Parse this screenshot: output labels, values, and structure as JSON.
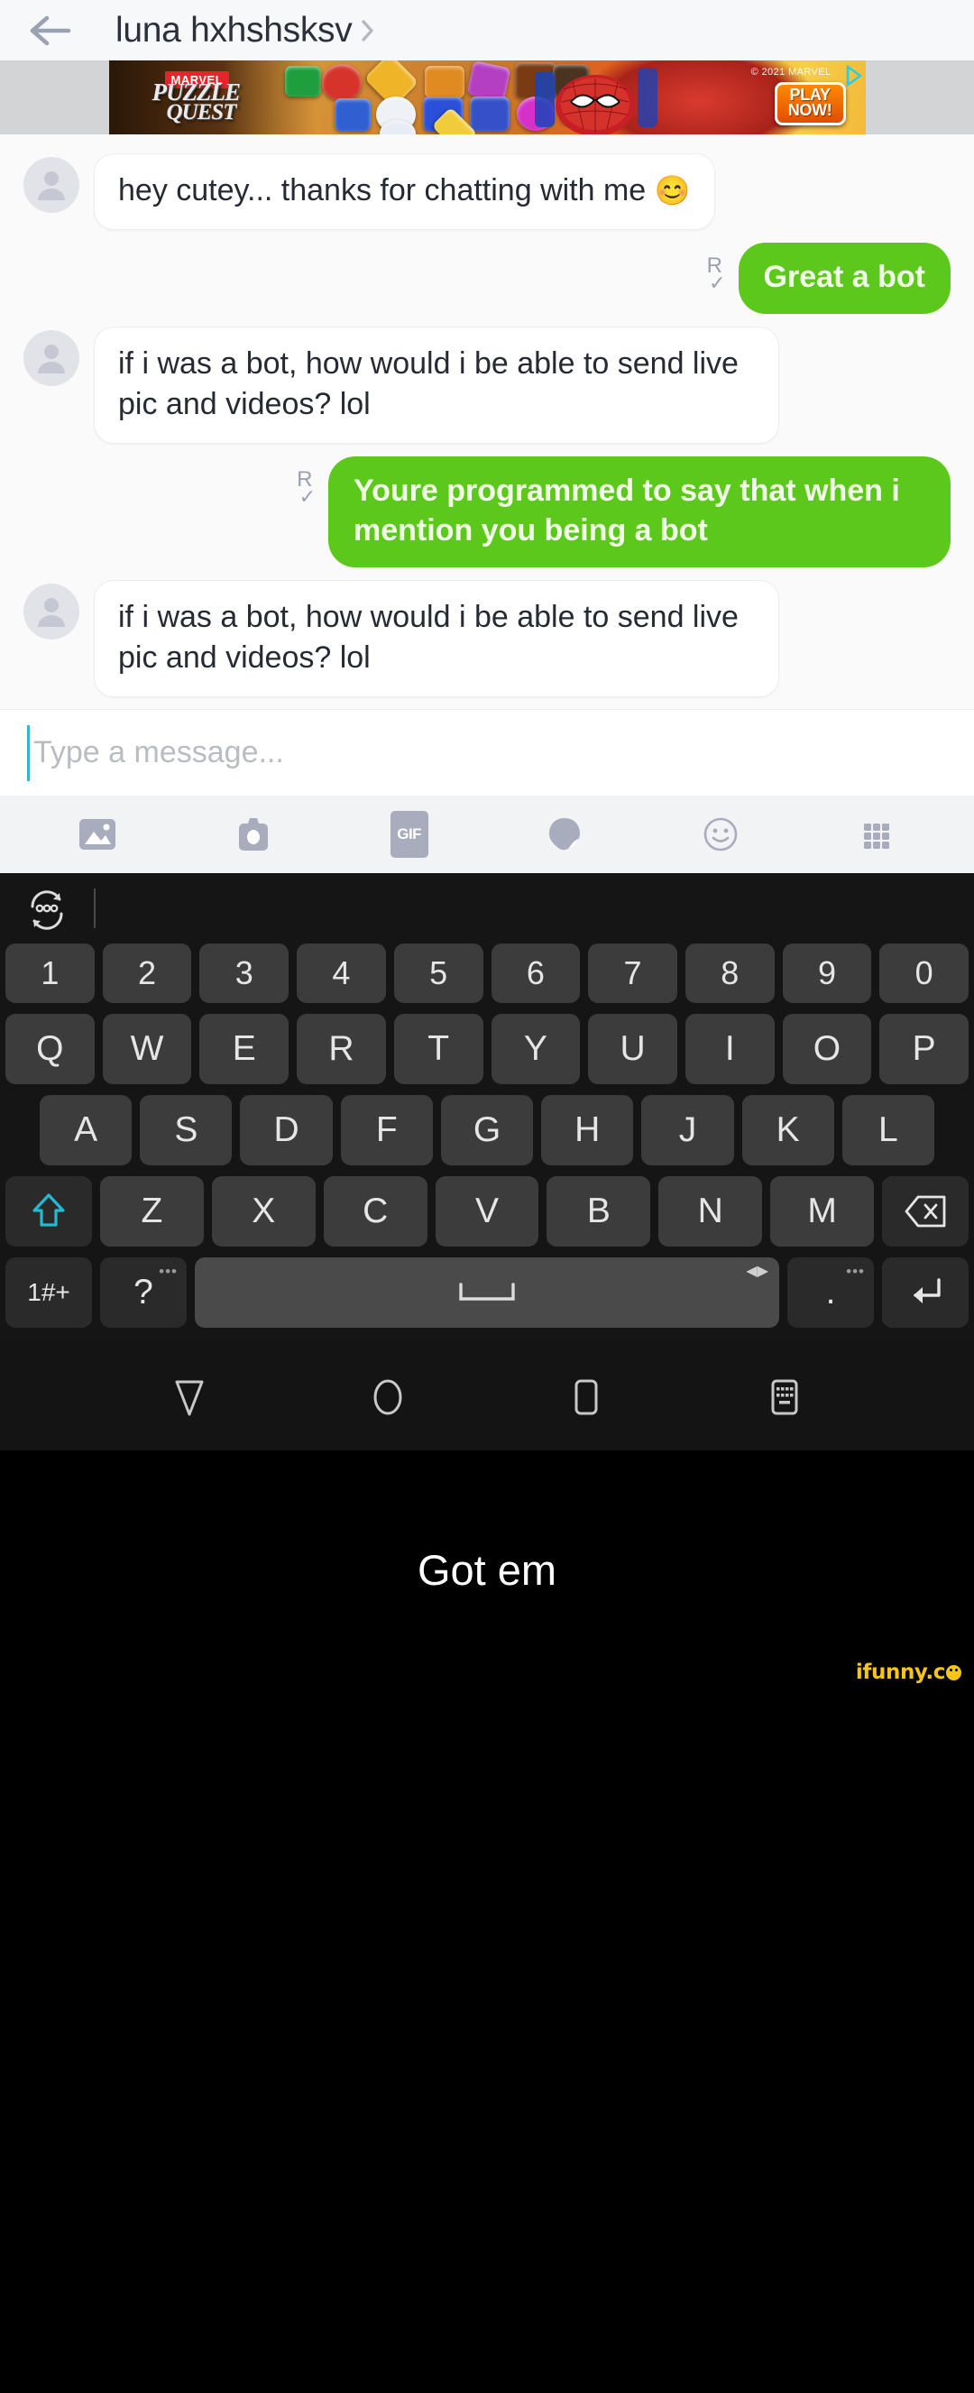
{
  "header": {
    "back_icon": "back-arrow-icon",
    "title": "luna hxhshsksv",
    "chevron_icon": "chevron-right-icon"
  },
  "ad": {
    "brand": "MARVEL",
    "title_line1": "PUZZLE",
    "title_line2": "QUEST",
    "copyright": "© 2021 MARVEL",
    "cta_line1": "PLAY",
    "cta_line2": "NOW!",
    "info_icon": "ad-info-icon"
  },
  "chat": {
    "read_mark_letter": "R",
    "read_mark_tick": "✓",
    "messages": [
      {
        "side": "in",
        "text": "hey cutey... thanks for chatting with me ",
        "emoji": "😊",
        "avatar_icon": "person-avatar-icon"
      },
      {
        "side": "out",
        "text": "Great a bot"
      },
      {
        "side": "in",
        "text": "if i was a bot, how would i be able to send live pic and videos? lol",
        "emoji": "",
        "avatar_icon": "person-avatar-icon"
      },
      {
        "side": "out",
        "text": "Youre programmed to say that when i mention you being a bot"
      },
      {
        "side": "in",
        "text": "if i was a bot, how would i be able to send live pic and videos? lol",
        "emoji": "",
        "avatar_icon": "person-avatar-icon"
      }
    ]
  },
  "composer": {
    "placeholder": "Type a message...",
    "value": ""
  },
  "attach_bar": {
    "items": [
      {
        "icon": "gallery-icon",
        "label": ""
      },
      {
        "icon": "camera-icon",
        "label": ""
      },
      {
        "icon": "gif-icon",
        "label": "GIF"
      },
      {
        "icon": "sticker-icon",
        "label": ""
      },
      {
        "icon": "emoji-icon",
        "label": ""
      },
      {
        "icon": "apps-grid-icon",
        "label": ""
      }
    ]
  },
  "keyboard": {
    "suggestion_icon": "refresh-suggestions-icon",
    "rows": {
      "numbers": [
        "1",
        "2",
        "3",
        "4",
        "5",
        "6",
        "7",
        "8",
        "9",
        "0"
      ],
      "top": [
        "Q",
        "W",
        "E",
        "R",
        "T",
        "Y",
        "U",
        "I",
        "O",
        "P"
      ],
      "home": [
        "A",
        "S",
        "D",
        "F",
        "G",
        "H",
        "J",
        "K",
        "L"
      ],
      "bottom": [
        "Z",
        "X",
        "C",
        "V",
        "B",
        "N",
        "M"
      ]
    },
    "shift_icon": "shift-caps-icon",
    "backspace_icon": "backspace-icon",
    "symbols_key": "1#+",
    "question_key": "?",
    "question_dots": "•••",
    "space_icon": "space-icon",
    "space_arrows": "◀▶",
    "period_key": ".",
    "period_dots": "•••",
    "enter_icon": "enter-icon"
  },
  "navbar": {
    "items": [
      {
        "icon": "nav-back-icon"
      },
      {
        "icon": "nav-home-icon"
      },
      {
        "icon": "nav-recents-icon"
      },
      {
        "icon": "hide-keyboard-icon"
      }
    ]
  },
  "caption": {
    "text": "Got em",
    "watermark": "ifunny.c",
    "watermark_suffix": "o"
  },
  "colors": {
    "outgoing_bubble": "#5cc81c",
    "header_bg": "#f7f8f9",
    "chat_bg": "#fafafa",
    "keyboard_bg": "#151515",
    "shift_accent": "#21bcd4",
    "watermark": "#f5c518"
  }
}
